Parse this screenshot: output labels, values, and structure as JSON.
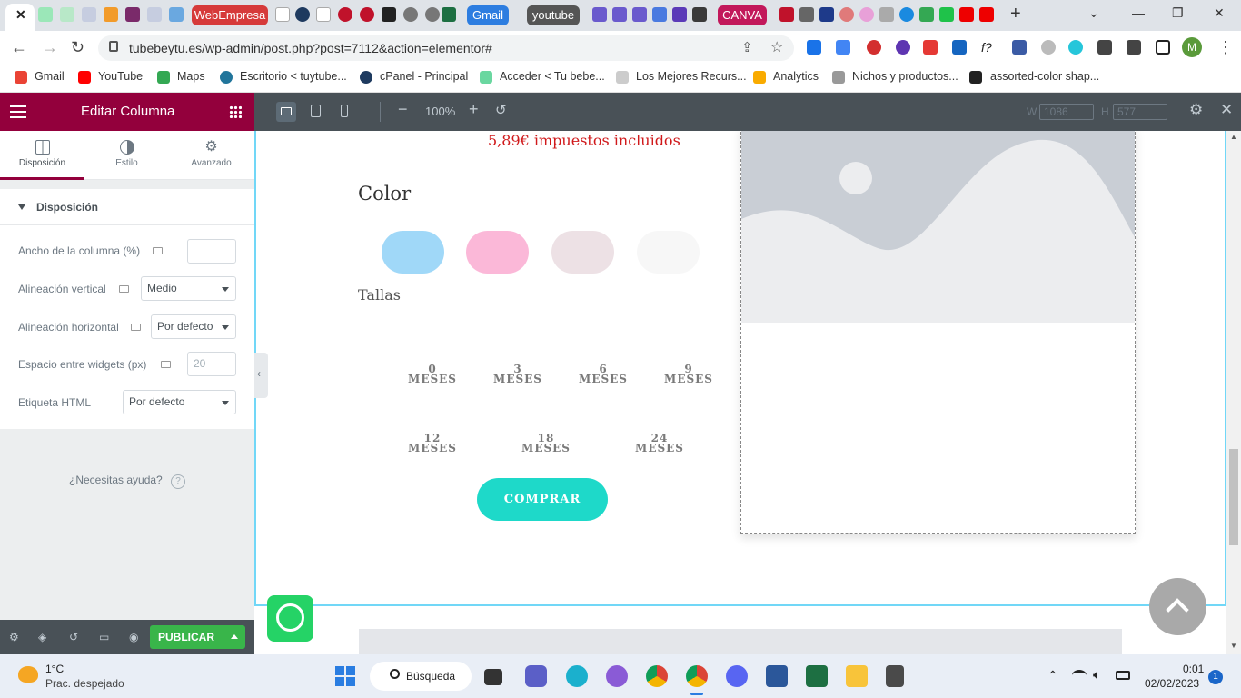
{
  "browser": {
    "tabs": {
      "webempresa": "WebEmpresa",
      "gmail": "Gmail",
      "youtube": "youtube",
      "canva": "CANVA"
    },
    "url": "tubebeytu.es/wp-admin/post.php?post=7112&action=elementor#",
    "bookmarks": [
      "Gmail",
      "YouTube",
      "Maps",
      "Escritorio < tuytube...",
      "cPanel - Principal",
      "Acceder < Tu bebe...",
      "Los Mejores Recurs...",
      "Analytics",
      "Nichos y productos...",
      "assorted-color shap..."
    ],
    "profile_initial": "M"
  },
  "editor": {
    "title": "Editar Columna",
    "tabs": [
      "Disposición",
      "Estilo",
      "Avanzado"
    ],
    "section_title": "Disposición",
    "controls": {
      "column_width_label": "Ancho de la columna (%)",
      "vertical_align_label": "Alineación vertical",
      "vertical_align_value": "Medio",
      "horizontal_align_label": "Alineación horizontal",
      "horizontal_align_value": "Por defecto",
      "widget_space_label": "Espacio entre widgets (px)",
      "widget_space_placeholder": "20",
      "html_tag_label": "Etiqueta HTML",
      "html_tag_value": "Por defecto"
    },
    "help": "¿Necesitas ayuda?",
    "publish": "PUBLICAR"
  },
  "preview_toolbar": {
    "zoom": "100%",
    "width_label": "W",
    "width_value": "1086",
    "height_label": "H",
    "height_value": "577"
  },
  "product": {
    "price_note": "5,89€ impuestos incluidos",
    "color_heading": "Color",
    "swatch_colors": [
      "#a0d8f8",
      "#fbb8d8",
      "#ede1e5",
      "#f7f7f7"
    ],
    "sizes_heading": "Tallas",
    "sizes_row1": [
      {
        "n": "0",
        "unit": "MESES"
      },
      {
        "n": "3",
        "unit": "MESES"
      },
      {
        "n": "6",
        "unit": "MESES"
      },
      {
        "n": "9",
        "unit": "MESES"
      }
    ],
    "sizes_row2": [
      {
        "n": "12",
        "unit": "MESES"
      },
      {
        "n": "18",
        "unit": "MESES"
      },
      {
        "n": "24",
        "unit": "MESES"
      }
    ],
    "buy_button": "COMPRAR"
  },
  "taskbar": {
    "weather_temp": "1°C",
    "weather_desc": "Prac. despejado",
    "search": "Búsqueda",
    "time": "0:01",
    "date": "02/02/2023",
    "notifications": "1"
  },
  "colors": {
    "elementor_brand": "#93003c",
    "accent_teal": "#1ed9c9",
    "publish_green": "#39b54a",
    "price_red": "#d0191b"
  }
}
